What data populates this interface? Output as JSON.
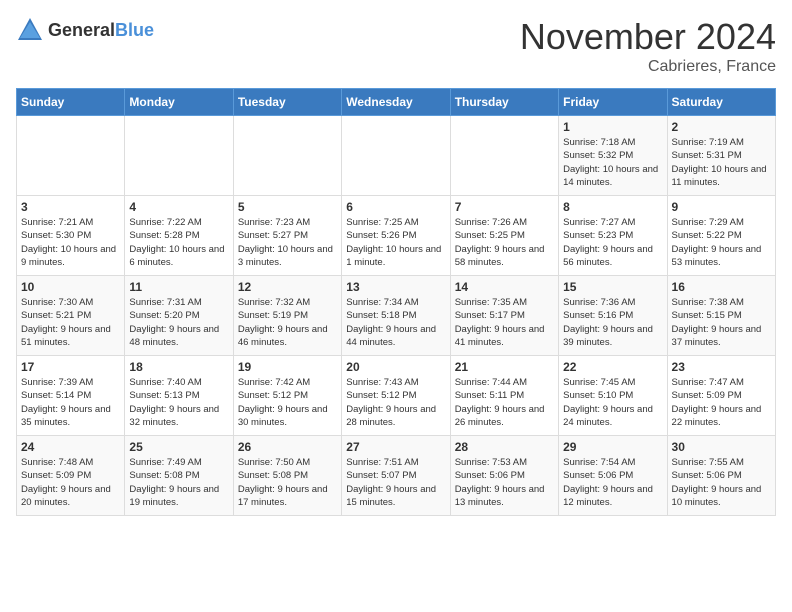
{
  "header": {
    "logo_general": "General",
    "logo_blue": "Blue",
    "title": "November 2024",
    "location": "Cabrieres, France"
  },
  "days_of_week": [
    "Sunday",
    "Monday",
    "Tuesday",
    "Wednesday",
    "Thursday",
    "Friday",
    "Saturday"
  ],
  "weeks": [
    [
      {
        "day": "",
        "info": ""
      },
      {
        "day": "",
        "info": ""
      },
      {
        "day": "",
        "info": ""
      },
      {
        "day": "",
        "info": ""
      },
      {
        "day": "",
        "info": ""
      },
      {
        "day": "1",
        "info": "Sunrise: 7:18 AM\nSunset: 5:32 PM\nDaylight: 10 hours and 14 minutes."
      },
      {
        "day": "2",
        "info": "Sunrise: 7:19 AM\nSunset: 5:31 PM\nDaylight: 10 hours and 11 minutes."
      }
    ],
    [
      {
        "day": "3",
        "info": "Sunrise: 7:21 AM\nSunset: 5:30 PM\nDaylight: 10 hours and 9 minutes."
      },
      {
        "day": "4",
        "info": "Sunrise: 7:22 AM\nSunset: 5:28 PM\nDaylight: 10 hours and 6 minutes."
      },
      {
        "day": "5",
        "info": "Sunrise: 7:23 AM\nSunset: 5:27 PM\nDaylight: 10 hours and 3 minutes."
      },
      {
        "day": "6",
        "info": "Sunrise: 7:25 AM\nSunset: 5:26 PM\nDaylight: 10 hours and 1 minute."
      },
      {
        "day": "7",
        "info": "Sunrise: 7:26 AM\nSunset: 5:25 PM\nDaylight: 9 hours and 58 minutes."
      },
      {
        "day": "8",
        "info": "Sunrise: 7:27 AM\nSunset: 5:23 PM\nDaylight: 9 hours and 56 minutes."
      },
      {
        "day": "9",
        "info": "Sunrise: 7:29 AM\nSunset: 5:22 PM\nDaylight: 9 hours and 53 minutes."
      }
    ],
    [
      {
        "day": "10",
        "info": "Sunrise: 7:30 AM\nSunset: 5:21 PM\nDaylight: 9 hours and 51 minutes."
      },
      {
        "day": "11",
        "info": "Sunrise: 7:31 AM\nSunset: 5:20 PM\nDaylight: 9 hours and 48 minutes."
      },
      {
        "day": "12",
        "info": "Sunrise: 7:32 AM\nSunset: 5:19 PM\nDaylight: 9 hours and 46 minutes."
      },
      {
        "day": "13",
        "info": "Sunrise: 7:34 AM\nSunset: 5:18 PM\nDaylight: 9 hours and 44 minutes."
      },
      {
        "day": "14",
        "info": "Sunrise: 7:35 AM\nSunset: 5:17 PM\nDaylight: 9 hours and 41 minutes."
      },
      {
        "day": "15",
        "info": "Sunrise: 7:36 AM\nSunset: 5:16 PM\nDaylight: 9 hours and 39 minutes."
      },
      {
        "day": "16",
        "info": "Sunrise: 7:38 AM\nSunset: 5:15 PM\nDaylight: 9 hours and 37 minutes."
      }
    ],
    [
      {
        "day": "17",
        "info": "Sunrise: 7:39 AM\nSunset: 5:14 PM\nDaylight: 9 hours and 35 minutes."
      },
      {
        "day": "18",
        "info": "Sunrise: 7:40 AM\nSunset: 5:13 PM\nDaylight: 9 hours and 32 minutes."
      },
      {
        "day": "19",
        "info": "Sunrise: 7:42 AM\nSunset: 5:12 PM\nDaylight: 9 hours and 30 minutes."
      },
      {
        "day": "20",
        "info": "Sunrise: 7:43 AM\nSunset: 5:12 PM\nDaylight: 9 hours and 28 minutes."
      },
      {
        "day": "21",
        "info": "Sunrise: 7:44 AM\nSunset: 5:11 PM\nDaylight: 9 hours and 26 minutes."
      },
      {
        "day": "22",
        "info": "Sunrise: 7:45 AM\nSunset: 5:10 PM\nDaylight: 9 hours and 24 minutes."
      },
      {
        "day": "23",
        "info": "Sunrise: 7:47 AM\nSunset: 5:09 PM\nDaylight: 9 hours and 22 minutes."
      }
    ],
    [
      {
        "day": "24",
        "info": "Sunrise: 7:48 AM\nSunset: 5:09 PM\nDaylight: 9 hours and 20 minutes."
      },
      {
        "day": "25",
        "info": "Sunrise: 7:49 AM\nSunset: 5:08 PM\nDaylight: 9 hours and 19 minutes."
      },
      {
        "day": "26",
        "info": "Sunrise: 7:50 AM\nSunset: 5:08 PM\nDaylight: 9 hours and 17 minutes."
      },
      {
        "day": "27",
        "info": "Sunrise: 7:51 AM\nSunset: 5:07 PM\nDaylight: 9 hours and 15 minutes."
      },
      {
        "day": "28",
        "info": "Sunrise: 7:53 AM\nSunset: 5:06 PM\nDaylight: 9 hours and 13 minutes."
      },
      {
        "day": "29",
        "info": "Sunrise: 7:54 AM\nSunset: 5:06 PM\nDaylight: 9 hours and 12 minutes."
      },
      {
        "day": "30",
        "info": "Sunrise: 7:55 AM\nSunset: 5:06 PM\nDaylight: 9 hours and 10 minutes."
      }
    ]
  ]
}
